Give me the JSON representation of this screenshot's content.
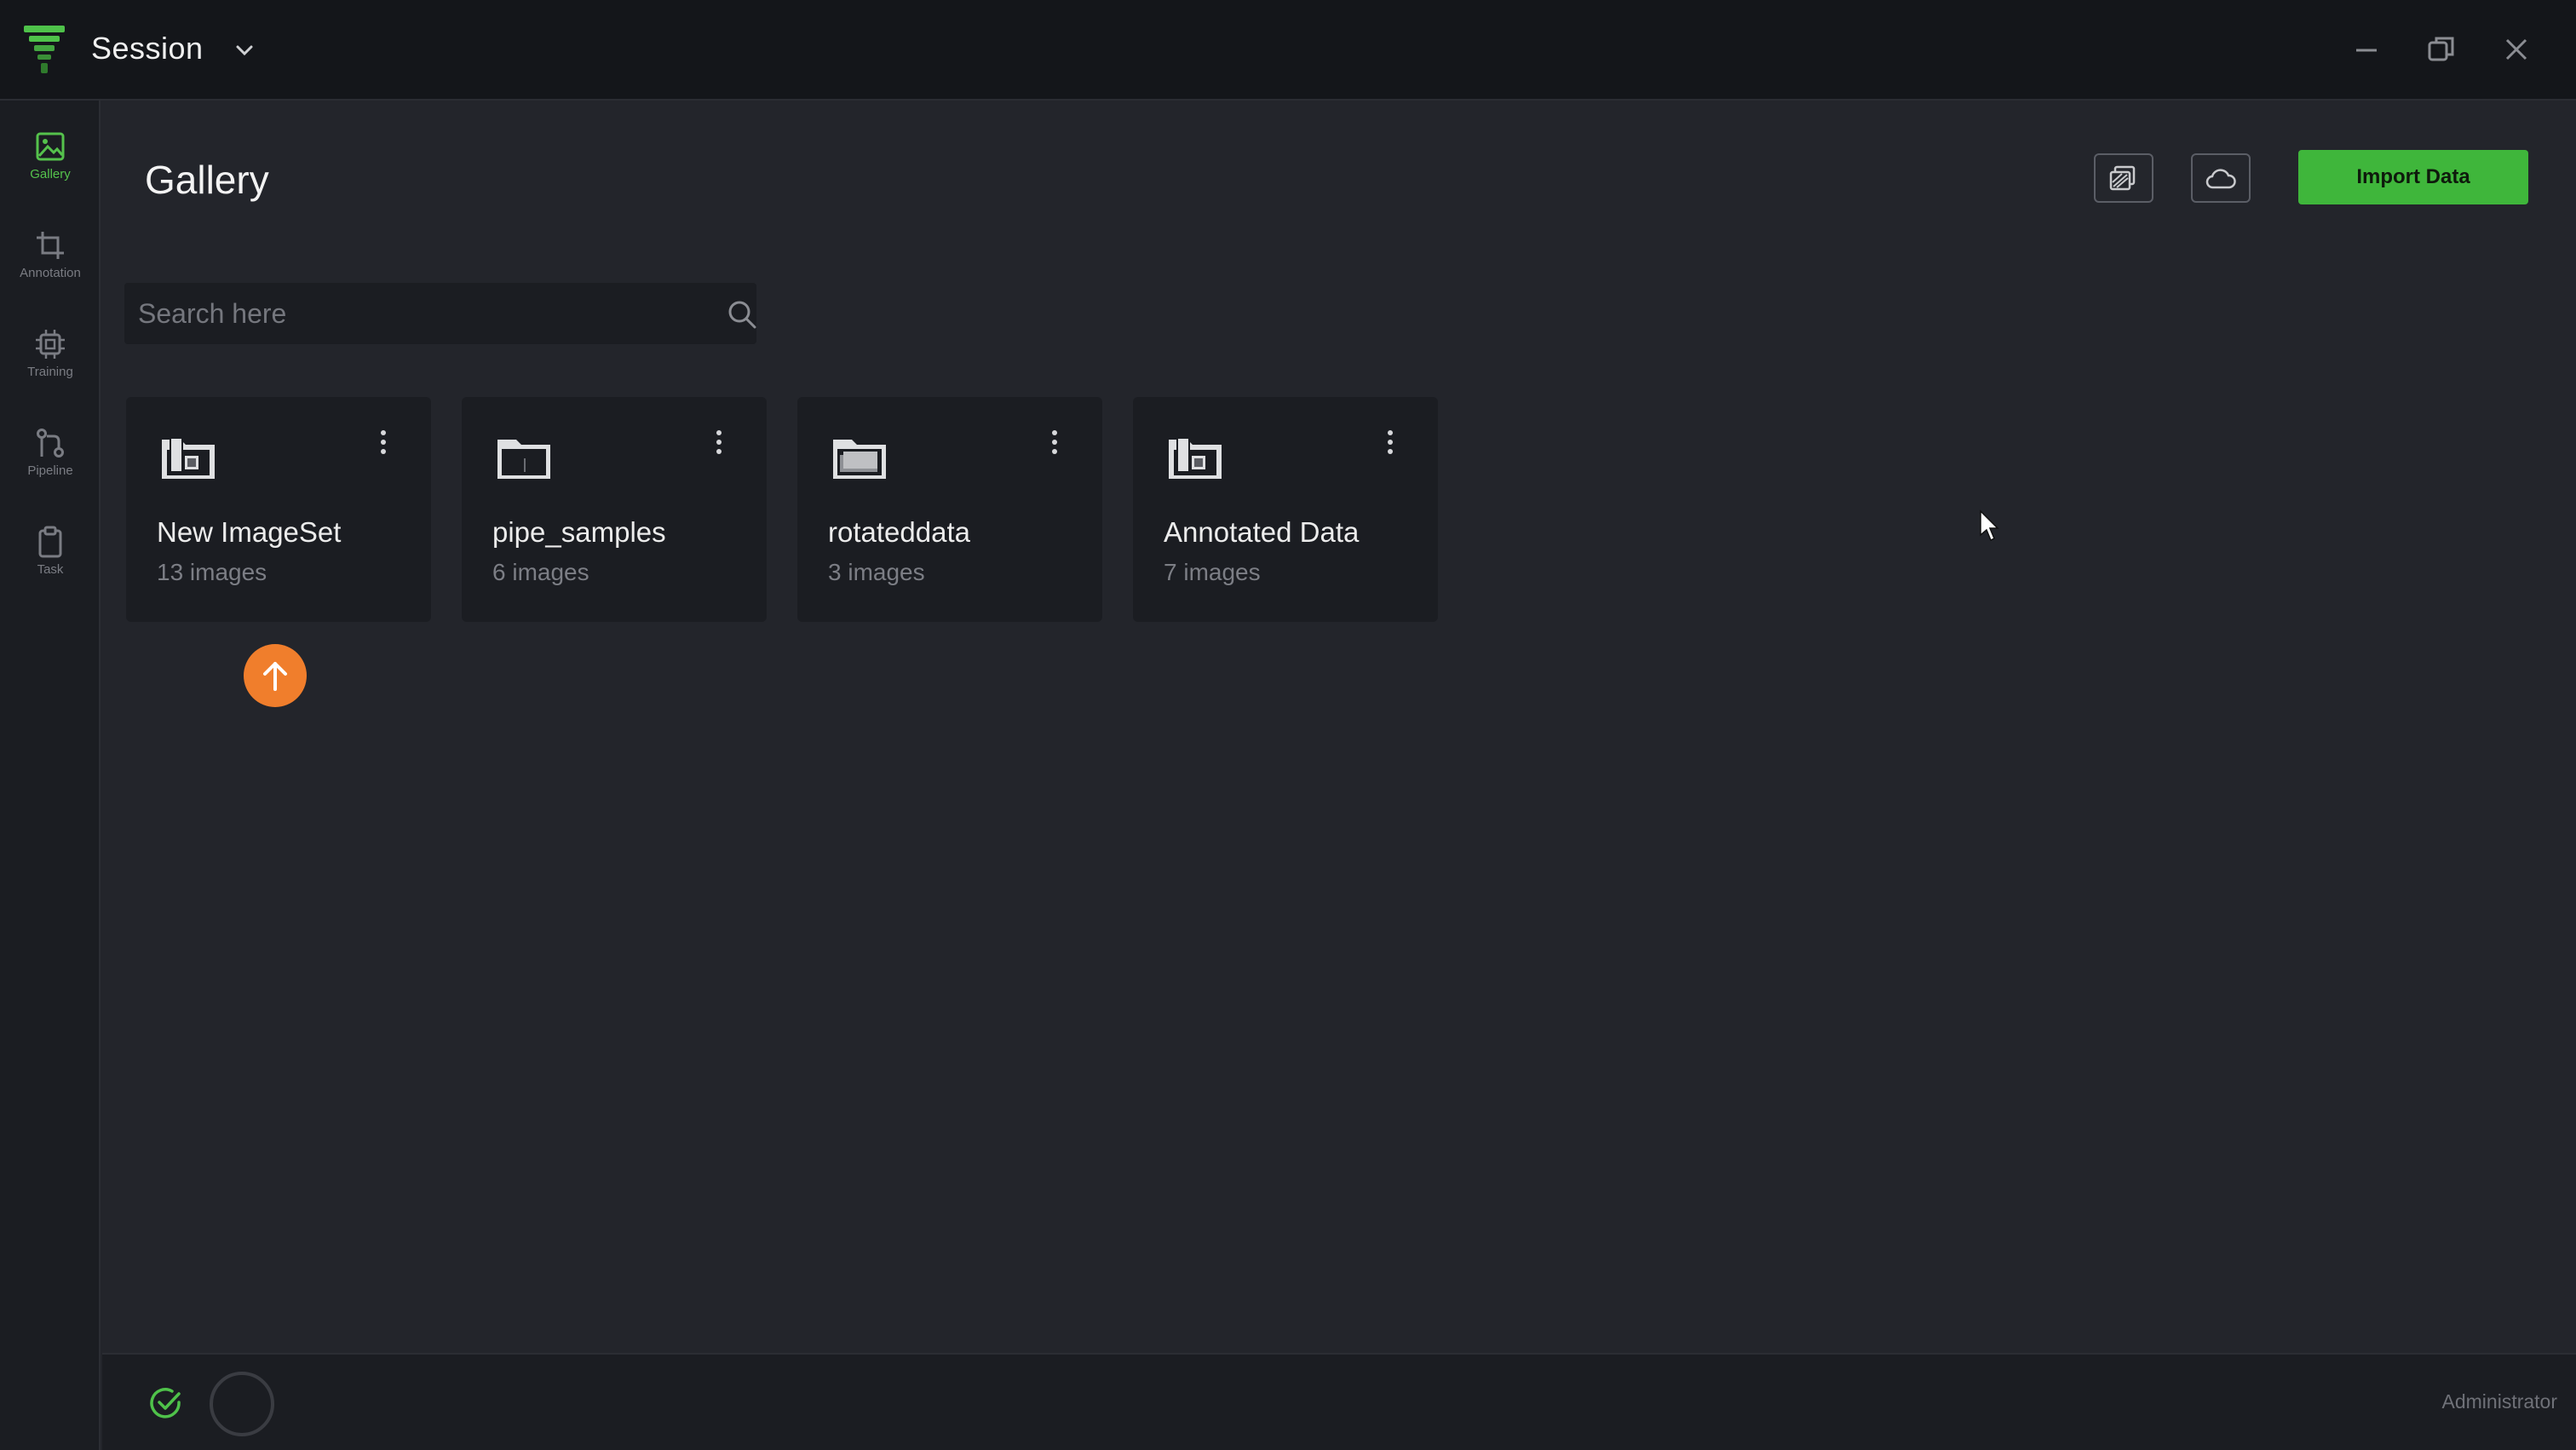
{
  "app": {
    "title": "Session",
    "accent_color": "#3fb63b"
  },
  "window_controls": [
    "minimize-icon",
    "restore-icon",
    "close-icon"
  ],
  "sidebar": {
    "items": [
      {
        "label": "Gallery",
        "icon": "gallery-icon",
        "active": true
      },
      {
        "label": "Annotation",
        "icon": "crop-icon",
        "active": false
      },
      {
        "label": "Training",
        "icon": "chip-icon",
        "active": false
      },
      {
        "label": "Pipeline",
        "icon": "pipeline-icon",
        "active": false
      },
      {
        "label": "Task",
        "icon": "clipboard-icon",
        "active": false
      }
    ]
  },
  "main": {
    "title": "Gallery",
    "toolbar": {
      "images_icon": "image-stack-icon",
      "cloud_icon": "cloud-icon",
      "import_label": "Import Data"
    },
    "search": {
      "placeholder": "Search here",
      "value": ""
    },
    "datasets": [
      {
        "name": "New ImageSet",
        "count": "13 images",
        "icon": "folder-images-icon"
      },
      {
        "name": "pipe_samples",
        "count": "6 images",
        "icon": "folder-empty-icon"
      },
      {
        "name": "rotateddata",
        "count": "3 images",
        "icon": "folder-open-icon"
      },
      {
        "name": "Annotated Data",
        "count": "7 images",
        "icon": "folder-images-icon"
      }
    ],
    "upload_color": "#f07e2c"
  },
  "statusbar": {
    "user": "Administrator",
    "status_icon": "check-circle-icon"
  }
}
